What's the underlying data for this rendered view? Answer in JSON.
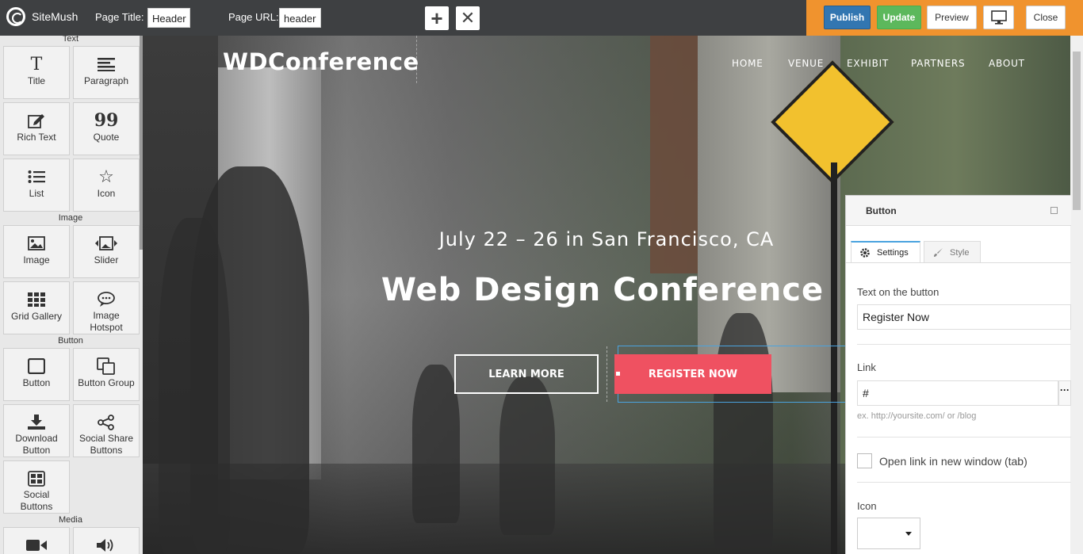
{
  "topbar": {
    "brand": "SiteMush",
    "page_title_label": "Page Title:",
    "page_title_value": "Header",
    "page_url_label": "Page URL:",
    "page_url_value": "header",
    "add_icon": "+",
    "remove_icon": "✕",
    "publish": "Publish",
    "update": "Update",
    "preview": "Preview",
    "close": "Close"
  },
  "sidebar": {
    "sections": {
      "text": "Text",
      "image": "Image",
      "button": "Button",
      "media": "Media"
    },
    "widgets": {
      "title": "Title",
      "paragraph": "Paragraph",
      "rich_text": "Rich Text",
      "quote": "Quote",
      "list": "List",
      "icon": "Icon",
      "image": "Image",
      "slider": "Slider",
      "grid_gallery": "Grid Gallery",
      "image_hotspot_1": "Image",
      "image_hotspot_2": "Hotspot",
      "button": "Button",
      "button_group": "Button Group",
      "download_1": "Download",
      "download_2": "Button",
      "social_share_1": "Social Share",
      "social_share_2": "Buttons",
      "social_buttons_1": "Social",
      "social_buttons_2": "Buttons"
    },
    "glyphs": {
      "title": "T",
      "quote": "99",
      "icon": "☆",
      "video": "■",
      "audio": "◀)"
    }
  },
  "site": {
    "logo": "WDConference",
    "nav": [
      "HOME",
      "VENUE",
      "EXHIBIT",
      "PARTNERS",
      "ABOUT"
    ],
    "date": "July 22 – 26 in San Francisco, CA",
    "title": "Web Design Conference",
    "learn_more": "LEARN MORE",
    "register_now": "REGISTER NOW"
  },
  "panel": {
    "title": "Button",
    "tab_settings": "Settings",
    "tab_style": "Style",
    "text_label": "Text on the button",
    "text_value": "Register Now",
    "link_label": "Link",
    "link_value": "#",
    "link_dots": "···",
    "link_hint": "ex. http://yoursite.com/ or /blog",
    "new_window_label": "Open link in new window (tab)",
    "new_window_checked": false,
    "icon_label": "Icon"
  },
  "colors": {
    "topbar": "#3e4042",
    "orange": "#f0932e",
    "publish": "#3276b1",
    "update": "#5cb85c",
    "register": "#ef5161",
    "selection": "#4aa3df"
  }
}
